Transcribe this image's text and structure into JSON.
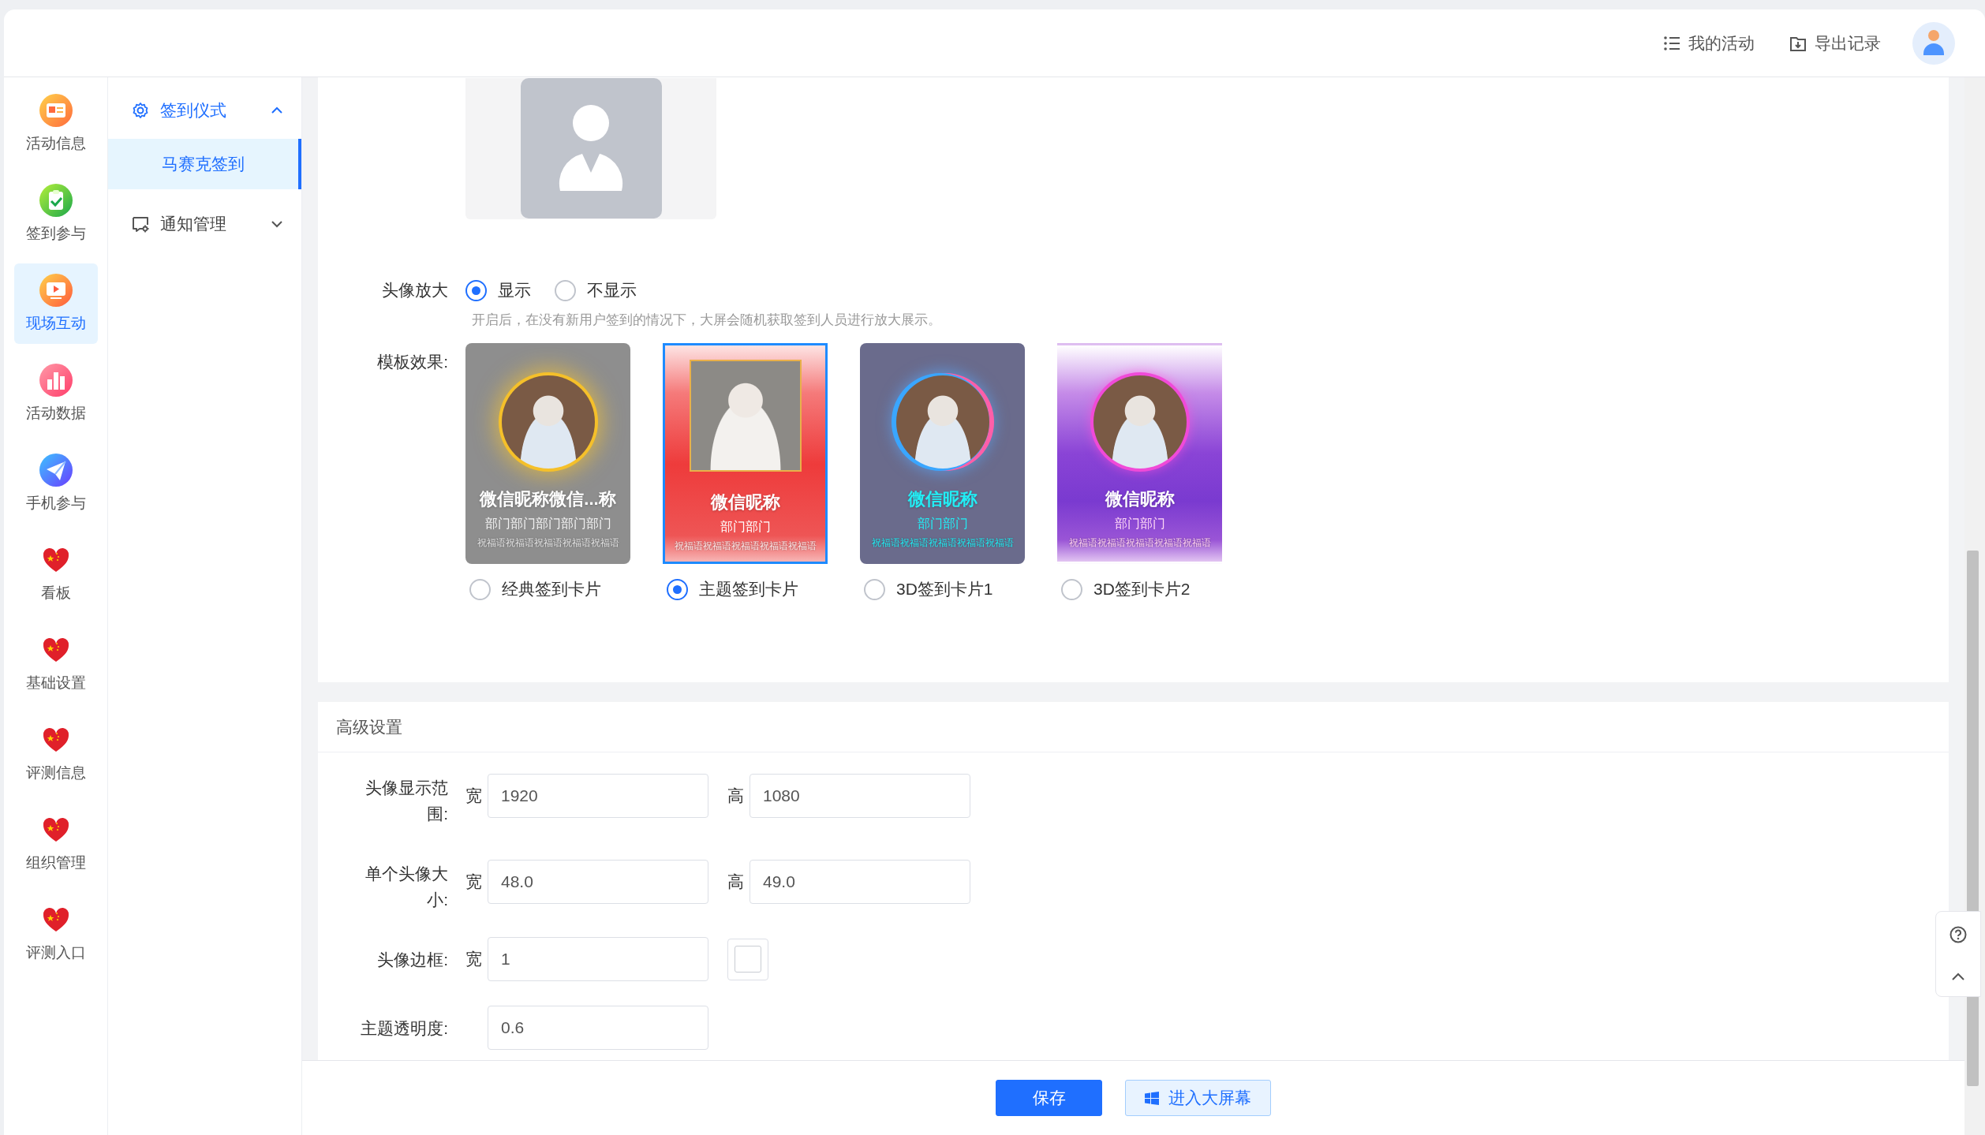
{
  "header": {
    "actions": [
      {
        "label": "我的活动",
        "kind": "list"
      },
      {
        "label": "导出记录",
        "kind": "export"
      }
    ]
  },
  "rail": [
    {
      "label": "活动信息",
      "kind": "id-card",
      "selected": false
    },
    {
      "label": "签到参与",
      "kind": "clipboard",
      "selected": false
    },
    {
      "label": "现场互动",
      "kind": "video",
      "selected": true
    },
    {
      "label": "活动数据",
      "kind": "chart",
      "selected": false
    },
    {
      "label": "手机参与",
      "kind": "plane",
      "selected": false
    },
    {
      "label": "看板",
      "kind": "heart",
      "selected": false
    },
    {
      "label": "基础设置",
      "kind": "heart",
      "selected": false
    },
    {
      "label": "评测信息",
      "kind": "heart",
      "selected": false
    },
    {
      "label": "组织管理",
      "kind": "heart",
      "selected": false
    },
    {
      "label": "评测入口",
      "kind": "heart",
      "selected": false
    }
  ],
  "submenu": [
    {
      "label": "签到仪式",
      "kind": "gear",
      "expanded": true,
      "children": [
        {
          "label": "马赛克签到",
          "selected": true
        }
      ]
    },
    {
      "label": "通知管理",
      "kind": "notice",
      "expanded": false
    }
  ],
  "avatar_zoom": {
    "label": "头像放大",
    "options": [
      {
        "label": "显示",
        "selected": true
      },
      {
        "label": "不显示",
        "selected": false
      }
    ],
    "hint": "开启后，在没有新用户签到的情况下，大屏会随机获取签到人员进行放大展示。"
  },
  "templates": {
    "label": "模板效果:",
    "items": [
      {
        "kind": "classic",
        "label": "经典签到卡片",
        "selected": false,
        "nickname": "微信昵称微信...称",
        "department": "部门部门部门部门部门",
        "blessing": "祝福语祝福语祝福语祝福语祝福语"
      },
      {
        "kind": "theme",
        "label": "主题签到卡片",
        "selected": true,
        "nickname": "微信昵称",
        "department": "部门部门",
        "blessing": "祝福语祝福语祝福语祝福语祝福语"
      },
      {
        "kind": "neon",
        "label": "3D签到卡片1",
        "selected": false,
        "nickname": "微信昵称",
        "department": "部门部门",
        "blessing": "祝福语祝福语祝福语祝福语祝福语"
      },
      {
        "kind": "purple",
        "label": "3D签到卡片2",
        "selected": false,
        "nickname": "微信昵称",
        "department": "部门部门",
        "blessing": "祝福语祝福语祝福语祝福语祝福语"
      }
    ]
  },
  "advanced": {
    "title": "高级设置",
    "rows": [
      {
        "label": "头像显示范围:",
        "fields": [
          {
            "kind": "input",
            "prefix": "宽",
            "value": "1920"
          },
          {
            "kind": "input",
            "prefix": "高",
            "value": "1080"
          }
        ]
      },
      {
        "label": "单个头像大小:",
        "fields": [
          {
            "kind": "input",
            "prefix": "宽",
            "value": "48.0"
          },
          {
            "kind": "input",
            "prefix": "高",
            "value": "49.0"
          }
        ]
      },
      {
        "label": "头像边框:",
        "fields": [
          {
            "kind": "input",
            "prefix": "宽",
            "value": "1"
          },
          {
            "kind": "swatch",
            "color": "#ffffff"
          }
        ]
      },
      {
        "label": "主题透明度:",
        "fields": [
          {
            "kind": "input",
            "value": "0.6"
          }
        ]
      }
    ]
  },
  "footer": {
    "buttons": [
      {
        "label": "保存",
        "kind": "primary"
      },
      {
        "label": "进入大屏幕",
        "kind": "screen"
      }
    ]
  }
}
